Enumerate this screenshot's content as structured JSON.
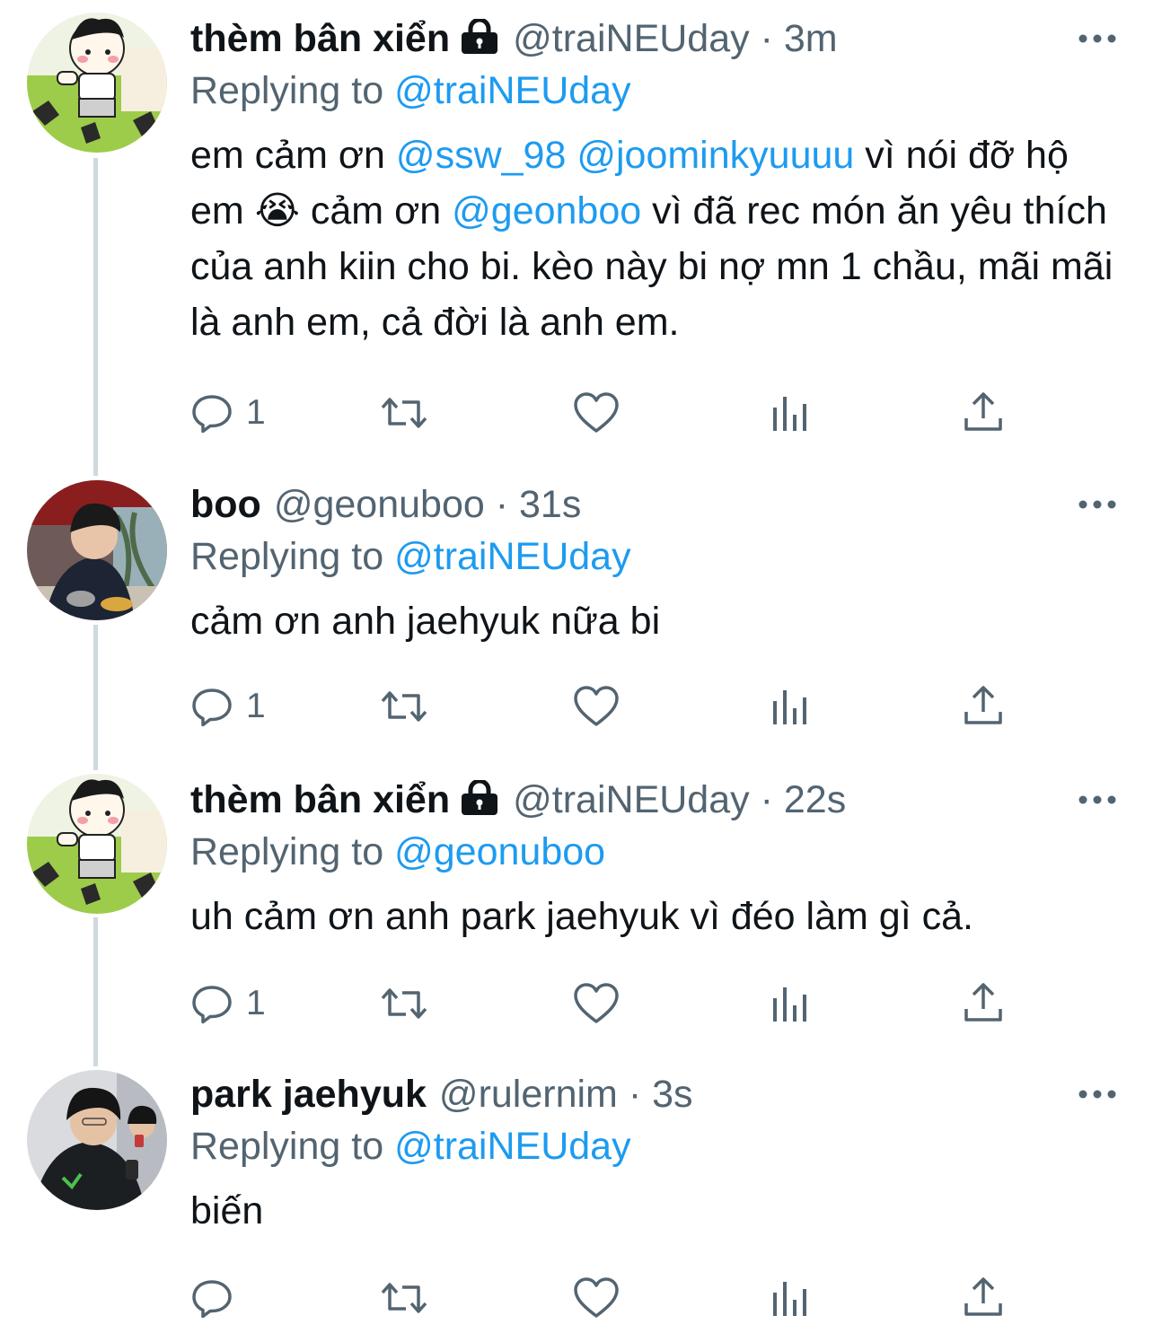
{
  "accent_color": "#1d9bf0",
  "muted_color": "#536471",
  "tweets": [
    {
      "name": "thèm bân xiển",
      "locked": true,
      "handle": "@traiNEUday",
      "separator": "·",
      "time": "3m",
      "replying_prefix": "Replying to",
      "replying_to": "@traiNEUday",
      "text_parts": [
        "em cảm ơn ",
        "@ssw_98",
        " ",
        "@joominkyuuuu",
        " vì nói đỡ hộ em ",
        "😭",
        "  cảm ơn ",
        "@geonboo",
        " vì đã rec món ăn yêu thích của anh kiin cho bi. kèo này bi nợ mn 1 chầu, mãi mãi là anh em, cả đời là anh em."
      ],
      "reply_count": "1",
      "avatar": "cartoon-avatar"
    },
    {
      "name": "boo",
      "locked": false,
      "handle": "@geonuboo",
      "separator": "·",
      "time": "31s",
      "replying_prefix": "Replying to",
      "replying_to": "@traiNEUday",
      "text": "cảm ơn anh jaehyuk nữa bi",
      "reply_count": "1",
      "avatar": "photo-avatar"
    },
    {
      "name": "thèm bân xiển",
      "locked": true,
      "handle": "@traiNEUday",
      "separator": "·",
      "time": "22s",
      "replying_prefix": "Replying to",
      "replying_to": "@geonuboo",
      "text": "uh cảm ơn anh park jaehyuk vì đéo làm gì cả.",
      "reply_count": "1",
      "avatar": "cartoon-avatar"
    },
    {
      "name": "park jaehyuk",
      "locked": false,
      "handle": "@rulernim",
      "separator": "·",
      "time": "3s",
      "replying_prefix": "Replying to",
      "replying_to": "@traiNEUday",
      "text": "biến",
      "reply_count": "",
      "avatar": "photo-avatar"
    }
  ]
}
